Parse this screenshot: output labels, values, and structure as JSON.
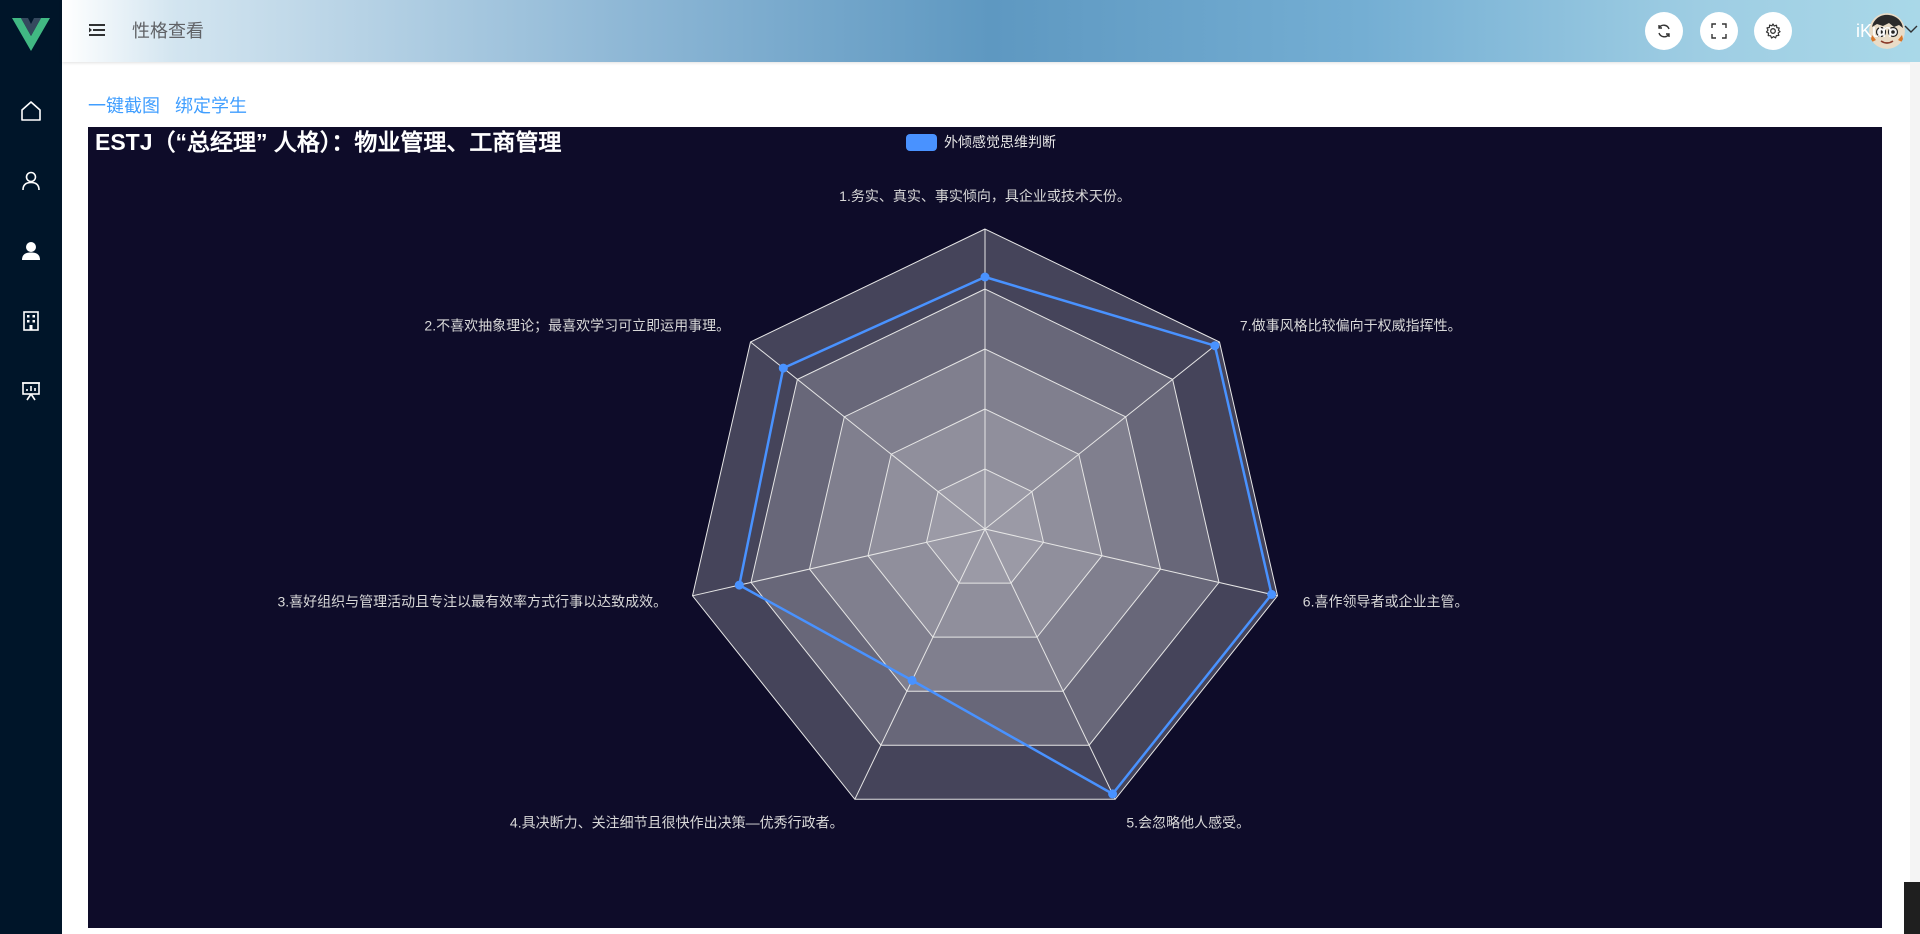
{
  "header": {
    "page_title": "性格查看",
    "username": "iKun",
    "icons": [
      "refresh-icon",
      "fullscreen-icon",
      "settings-icon"
    ]
  },
  "sidebar": {
    "items": [
      {
        "icon": "home-icon"
      },
      {
        "icon": "user-outline-icon"
      },
      {
        "icon": "user-filled-icon",
        "active": true
      },
      {
        "icon": "building-icon"
      },
      {
        "icon": "presentation-icon"
      }
    ]
  },
  "actions": {
    "screenshot_label": "一键截图",
    "bind_student_label": "绑定学生"
  },
  "colors": {
    "sidebar_bg": "#001529",
    "chart_bg": "#0e0c29",
    "series": "#4992ff",
    "link": "#409eff"
  },
  "chart_data": {
    "type": "radar",
    "title": "ESTJ（“总经理” 人格）：物业管理、工商管理",
    "legend_position": "top-center",
    "indicators": [
      "1.务实、真实、事实倾向，具企业或技术天份。",
      "2.不喜欢抽象理论；最喜欢学习可立即运用事理。",
      "3.喜好组织与管理活动且专注以最有效率方式行事以达致成效。",
      "4.具决断力、关注细节且很快作出决策—优秀行政者。",
      "5.会忽略他人感受。",
      "6.喜作领导者或企业主管。",
      "7.做事风格比较偏向于权威指挥性。"
    ],
    "max": 5,
    "split_number": 5,
    "series": [
      {
        "name": "外倾感觉思维判断",
        "values": [
          4.2,
          4.3,
          4.2,
          2.8,
          4.9,
          4.9,
          4.9
        ]
      }
    ]
  }
}
